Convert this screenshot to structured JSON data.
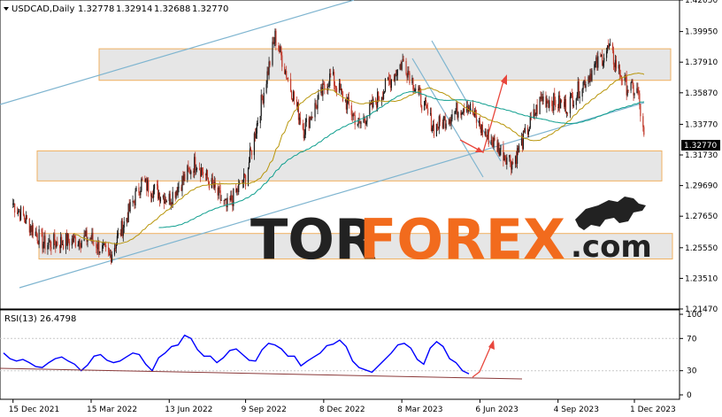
{
  "chart_data": [
    {
      "type": "candlestick",
      "title": "USDCAD,Daily",
      "ohlc_header": [
        "1.32778",
        "1.32914",
        "1.32688",
        "1.32770"
      ],
      "last_price_label": "1.32770",
      "y_ticks": [
        "1.42050",
        "1.39950",
        "1.37910",
        "1.35870",
        "1.33770",
        "1.31730",
        "1.29690",
        "1.27650",
        "1.25550",
        "1.23510",
        "1.21470"
      ],
      "ylim": [
        1.2147,
        1.4205
      ],
      "x_ticks": [
        "15 Dec 2021",
        "15 Mar 2022",
        "13 Jun 2022",
        "9 Sep 2022",
        "8 Dec 2022",
        "8 Mar 2023",
        "6 Jun 2023",
        "4 Sep 2023",
        "1 Dec 2023"
      ],
      "price_path_approx": [
        {
          "date": "2021-12-15",
          "close": 1.285
        },
        {
          "date": "2022-01-20",
          "close": 1.258
        },
        {
          "date": "2022-03-15",
          "close": 1.262
        },
        {
          "date": "2022-04-05",
          "close": 1.249
        },
        {
          "date": "2022-05-12",
          "close": 1.299
        },
        {
          "date": "2022-06-13",
          "close": 1.288
        },
        {
          "date": "2022-07-14",
          "close": 1.313
        },
        {
          "date": "2022-08-18",
          "close": 1.282
        },
        {
          "date": "2022-09-09",
          "close": 1.302
        },
        {
          "date": "2022-10-13",
          "close": 1.396
        },
        {
          "date": "2022-11-15",
          "close": 1.334
        },
        {
          "date": "2022-12-16",
          "close": 1.37
        },
        {
          "date": "2023-01-18",
          "close": 1.337
        },
        {
          "date": "2023-03-10",
          "close": 1.38
        },
        {
          "date": "2023-04-14",
          "close": 1.335
        },
        {
          "date": "2023-05-22",
          "close": 1.352
        },
        {
          "date": "2023-06-08",
          "close": 1.334
        },
        {
          "date": "2023-07-14",
          "close": 1.312
        },
        {
          "date": "2023-08-16",
          "close": 1.355
        },
        {
          "date": "2023-09-14",
          "close": 1.35
        },
        {
          "date": "2023-11-01",
          "close": 1.388
        },
        {
          "date": "2023-11-22",
          "close": 1.363
        },
        {
          "date": "2023-12-05",
          "close": 1.359
        },
        {
          "date": "2023-12-12",
          "close": 1.3277
        }
      ],
      "moving_averages": [
        {
          "name": "",
          "color": "#b8960c"
        },
        {
          "name": "",
          "color": "#0e9e8e"
        }
      ],
      "zones": [
        {
          "from": 1.367,
          "to": 1.388
        },
        {
          "from": 1.3,
          "to": 1.32
        },
        {
          "from": 1.248,
          "to": 1.265
        }
      ],
      "colors": {
        "up": "#1a1a1a",
        "down": "#c0392b",
        "zone": "#e6e6e6",
        "zone_border": "#f0b060",
        "trend": "#7fb5d0",
        "arrow": "#e8463c"
      }
    },
    {
      "type": "line",
      "title": "RSI(13) 26.4798",
      "y_ticks": [
        "100",
        "70",
        "30",
        "0"
      ],
      "ylim": [
        0,
        100
      ],
      "series": [
        {
          "name": "",
          "color": "#0000ff",
          "values": [
            52,
            45,
            42,
            44,
            40,
            35,
            34,
            40,
            45,
            47,
            42,
            38,
            30,
            37,
            48,
            50,
            43,
            40,
            42,
            47,
            52,
            50,
            38,
            30,
            46,
            52,
            60,
            62,
            74,
            70,
            56,
            48,
            48,
            40,
            46,
            55,
            57,
            50,
            43,
            42,
            56,
            64,
            62,
            57,
            48,
            48,
            36,
            42,
            47,
            52,
            61,
            63,
            68,
            60,
            42,
            34,
            31,
            28,
            36,
            44,
            52,
            62,
            64,
            58,
            44,
            38,
            58,
            66,
            60,
            45,
            40,
            30,
            26
          ]
        }
      ]
    }
  ],
  "watermark": {
    "brand_dark": "TOR",
    "brand_orange": "FOREX",
    "suffix": ".com"
  }
}
